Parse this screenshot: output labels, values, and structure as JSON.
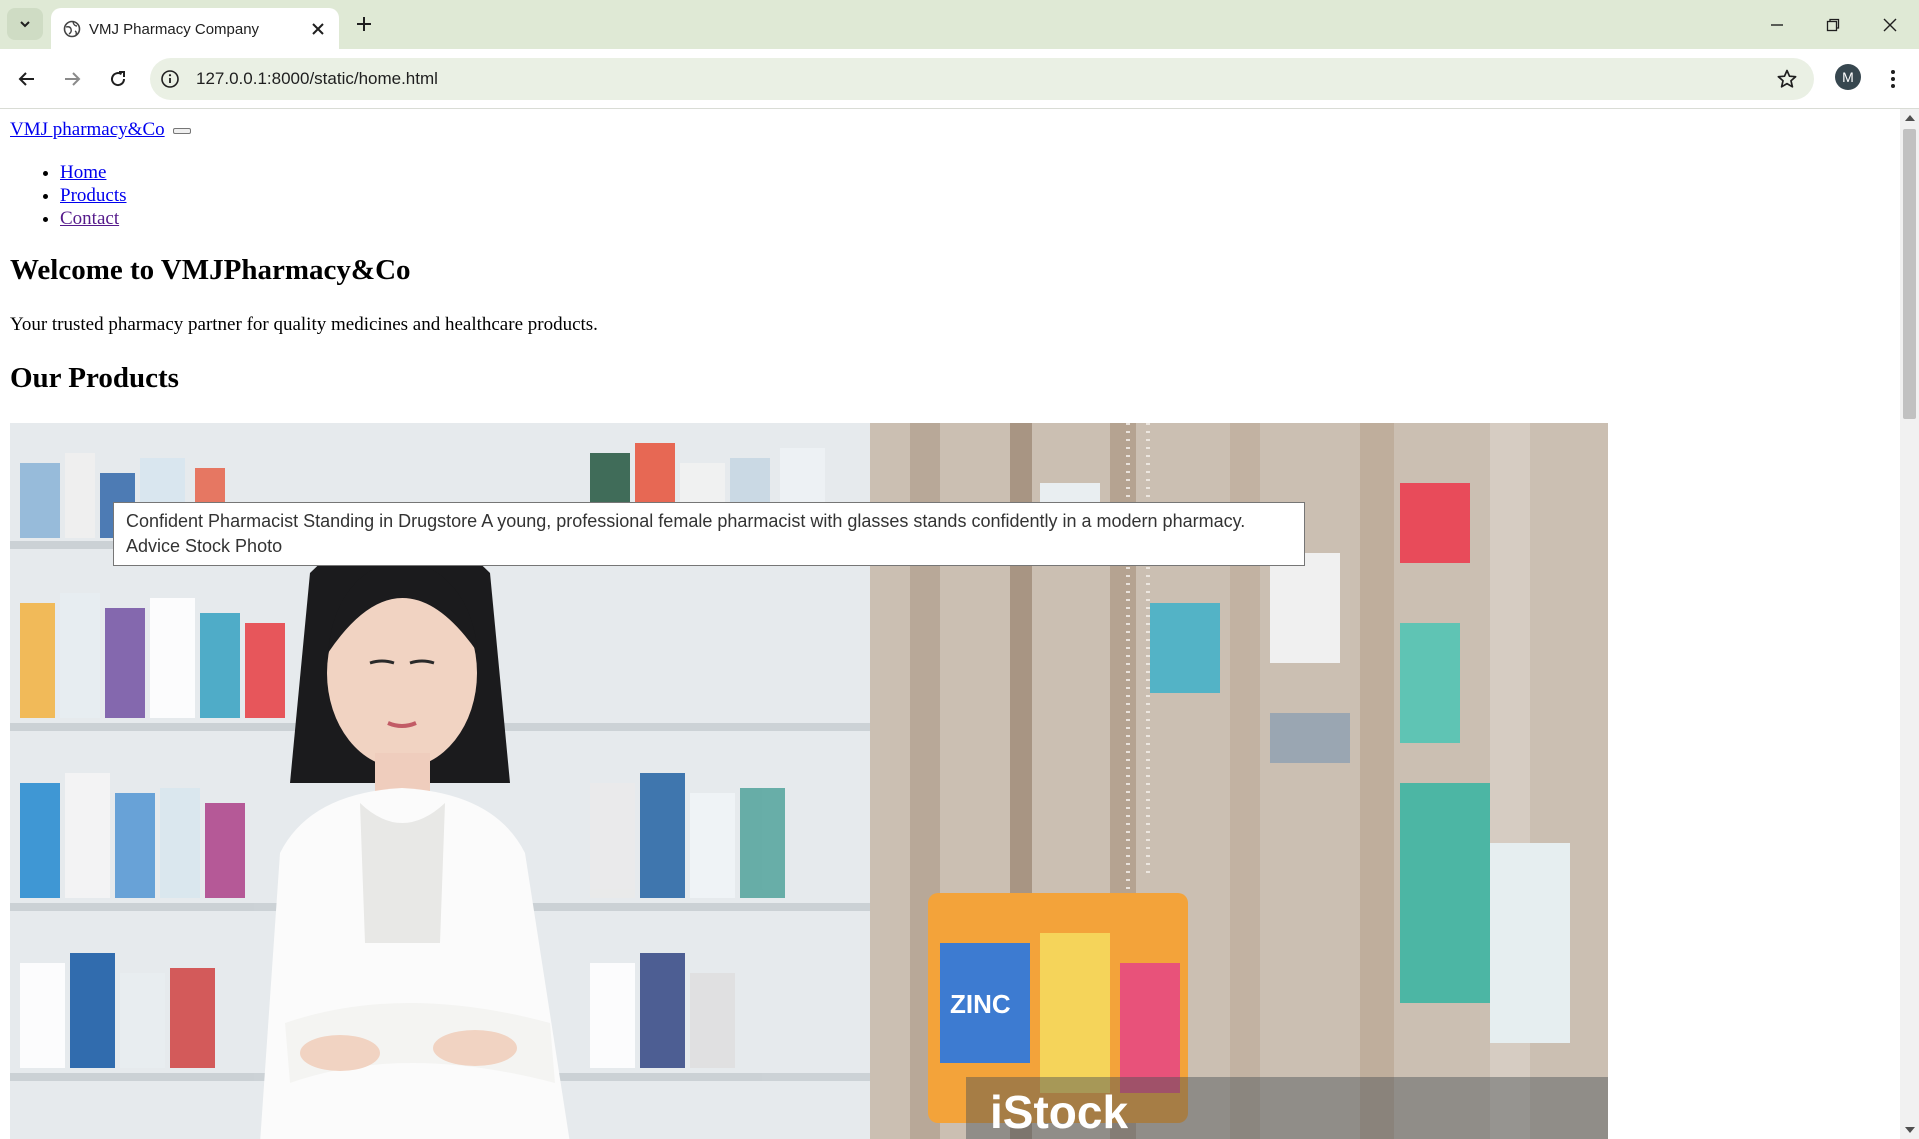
{
  "browser": {
    "tab_title": "VMJ Pharmacy Company",
    "url": "127.0.0.1:8000/static/home.html",
    "profile_initial": "M"
  },
  "page": {
    "brand": "VMJ pharmacy&Co",
    "nav": [
      "Home",
      "Products",
      "Contact"
    ],
    "heading": "Welcome to VMJPharmacy&Co",
    "tagline": "Your trusted pharmacy partner for quality medicines and healthcare products.",
    "products_heading": "Our Products",
    "image": {
      "tooltip": "Confident Pharmacist Standing in Drugstore A young, professional female pharmacist with glasses stands confidently in a modern pharmacy. Advice Stock Photo",
      "watermark": "iStock",
      "package_text": "ZINC"
    }
  }
}
